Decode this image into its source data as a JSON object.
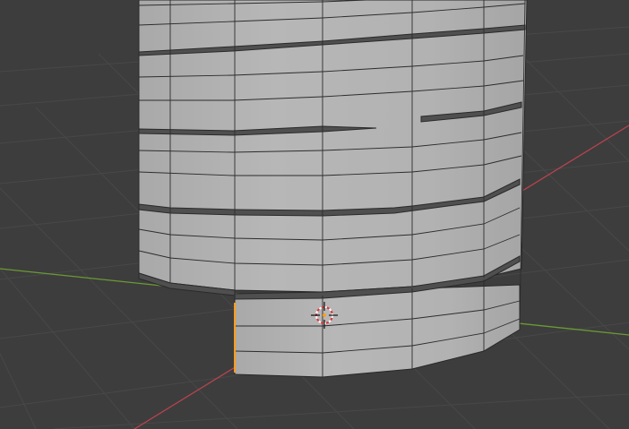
{
  "viewport": {
    "background_color": "#3d3d3d",
    "grid_color": "#474747",
    "x_axis_color": "#b8434f",
    "y_axis_color": "#6b9a34",
    "mesh_face_color": "#b4b4b4",
    "mesh_edge_color": "#282828",
    "mesh_gap_color": "#4a4a4a",
    "selected_edge_color": "#ff9d1c",
    "cursor_icon": "3d-cursor-icon"
  }
}
